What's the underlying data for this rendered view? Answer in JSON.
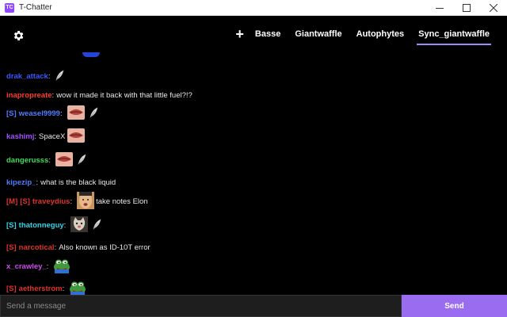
{
  "window": {
    "title": "T-Chatter",
    "app_icon_text": "TC"
  },
  "header": {
    "add_tab_label": "+",
    "tabs": [
      {
        "label": "Basse",
        "active": false
      },
      {
        "label": "Giantwaffle",
        "active": false
      },
      {
        "label": "Autophytes",
        "active": false
      },
      {
        "label": "Sync_giantwaffle",
        "active": true
      }
    ]
  },
  "colors": {
    "accent": "#9a6cf0",
    "tab_underline": "#9a8df7",
    "badge_red": "#e0312b",
    "badge_blue": "#4f7dff"
  },
  "messages": [
    {
      "badges": [],
      "user": "drak_attack",
      "color": "#3a56ff",
      "text": "",
      "emotes": [
        "feather-emote"
      ]
    },
    {
      "badges": [],
      "user": "inapropreate",
      "color": "#ff3b2e",
      "text": "wow it made it back with that little fuel?!?",
      "emotes": []
    },
    {
      "badges": [
        {
          "label": "[S]",
          "color": "#4f7dff"
        }
      ],
      "user": "weasel9999",
      "color": "#4f7dff",
      "text": "",
      "emotes": [
        "lips-emote",
        "feather-emote"
      ]
    },
    {
      "badges": [],
      "user": "kashimj",
      "color": "#a64dff",
      "text": "SpaceX",
      "emotes": [
        "lips-emote"
      ],
      "emote_after_text": true
    },
    {
      "badges": [],
      "user": "dangerusss",
      "color": "#3bdc5a",
      "text": "",
      "emotes": [
        "lips-emote",
        "feather-emote"
      ]
    },
    {
      "badges": [],
      "user": "kipezip_",
      "color": "#4f7dff",
      "text": "what is the black liquid",
      "emotes": []
    },
    {
      "badges": [
        {
          "label": "[M]",
          "color": "#e0312b"
        },
        {
          "label": "[S]",
          "color": "#e0312b"
        }
      ],
      "user": "traveydius",
      "color": "#e0312b",
      "text": "take notes Elon",
      "emotes": [
        "face-emote"
      ]
    },
    {
      "badges": [
        {
          "label": "[S]",
          "color": "#2fd4e6"
        }
      ],
      "user": "thatonneguy",
      "color": "#2fd4e6",
      "text": "",
      "emotes": [
        "cat-emote",
        "feather-emote"
      ]
    },
    {
      "badges": [
        {
          "label": "[S]",
          "color": "#e0312b"
        }
      ],
      "user": "narcotical",
      "color": "#e0312b",
      "text": "Also known as ID-10T error",
      "emotes": []
    },
    {
      "badges": [],
      "user": "x_crawley_",
      "color": "#d24bf0",
      "text": "",
      "emotes": [
        "pepe-emote"
      ]
    },
    {
      "badges": [
        {
          "label": "[S]",
          "color": "#e0312b"
        }
      ],
      "user": "aetherstrom",
      "color": "#e0312b",
      "text": "",
      "emotes": [
        "pepe-emote"
      ]
    }
  ],
  "input": {
    "placeholder": "Send a message",
    "value": ""
  },
  "send_button": {
    "label": "Send"
  }
}
